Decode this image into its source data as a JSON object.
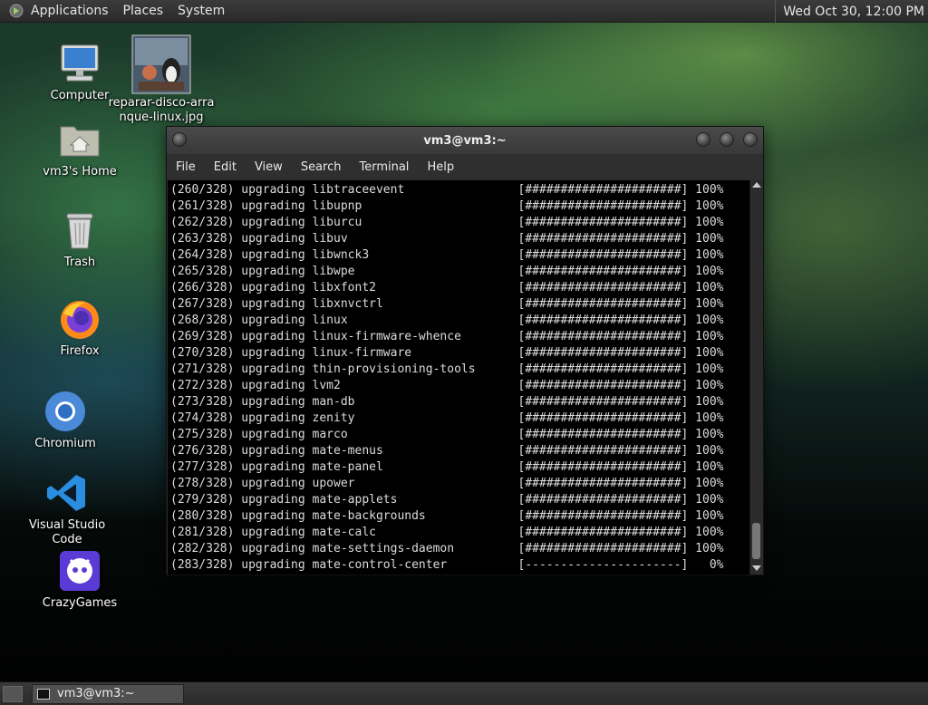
{
  "top_panel": {
    "menus": [
      "Applications",
      "Places",
      "System"
    ],
    "clock": "Wed Oct 30, 12:00 PM"
  },
  "desktop_icons": [
    {
      "label": "Computer",
      "icon": "computer-icon"
    },
    {
      "label": "reparar-disco-arranque-linux.jpg",
      "icon": "image-file-icon"
    },
    {
      "label": "vm3's Home",
      "icon": "home-folder-icon"
    },
    {
      "label": "Trash",
      "icon": "trash-icon"
    },
    {
      "label": "Firefox",
      "icon": "firefox-icon"
    },
    {
      "label": "Chromium",
      "icon": "chromium-icon"
    },
    {
      "label": "Visual Studio Code",
      "icon": "vscode-icon"
    },
    {
      "label": "CrazyGames",
      "icon": "crazygames-icon"
    }
  ],
  "terminal": {
    "title": "vm3@vm3:~",
    "menu": [
      "File",
      "Edit",
      "View",
      "Search",
      "Terminal",
      "Help"
    ],
    "lines": [
      "(260/328) upgrading libtraceevent                [######################] 100%",
      "(261/328) upgrading libupnp                      [######################] 100%",
      "(262/328) upgrading liburcu                      [######################] 100%",
      "(263/328) upgrading libuv                        [######################] 100%",
      "(264/328) upgrading libwnck3                     [######################] 100%",
      "(265/328) upgrading libwpe                       [######################] 100%",
      "(266/328) upgrading libxfont2                    [######################] 100%",
      "(267/328) upgrading libxnvctrl                   [######################] 100%",
      "(268/328) upgrading linux                        [######################] 100%",
      "(269/328) upgrading linux-firmware-whence        [######################] 100%",
      "(270/328) upgrading linux-firmware               [######################] 100%",
      "(271/328) upgrading thin-provisioning-tools      [######################] 100%",
      "(272/328) upgrading lvm2                         [######################] 100%",
      "(273/328) upgrading man-db                       [######################] 100%",
      "(274/328) upgrading zenity                       [######################] 100%",
      "(275/328) upgrading marco                        [######################] 100%",
      "(276/328) upgrading mate-menus                   [######################] 100%",
      "(277/328) upgrading mate-panel                   [######################] 100%",
      "(278/328) upgrading upower                       [######################] 100%",
      "(279/328) upgrading mate-applets                 [######################] 100%",
      "(280/328) upgrading mate-backgrounds             [######################] 100%",
      "(281/328) upgrading mate-calc                    [######################] 100%",
      "(282/328) upgrading mate-settings-daemon         [######################] 100%",
      "(283/328) upgrading mate-control-center          [----------------------]   0%"
    ]
  },
  "taskbar": {
    "items": [
      {
        "label": "vm3@vm3:~"
      }
    ]
  },
  "colors": {
    "panel": "#2f2f2f",
    "terminal_bg": "#000000",
    "terminal_fg": "#dcdcdc"
  }
}
